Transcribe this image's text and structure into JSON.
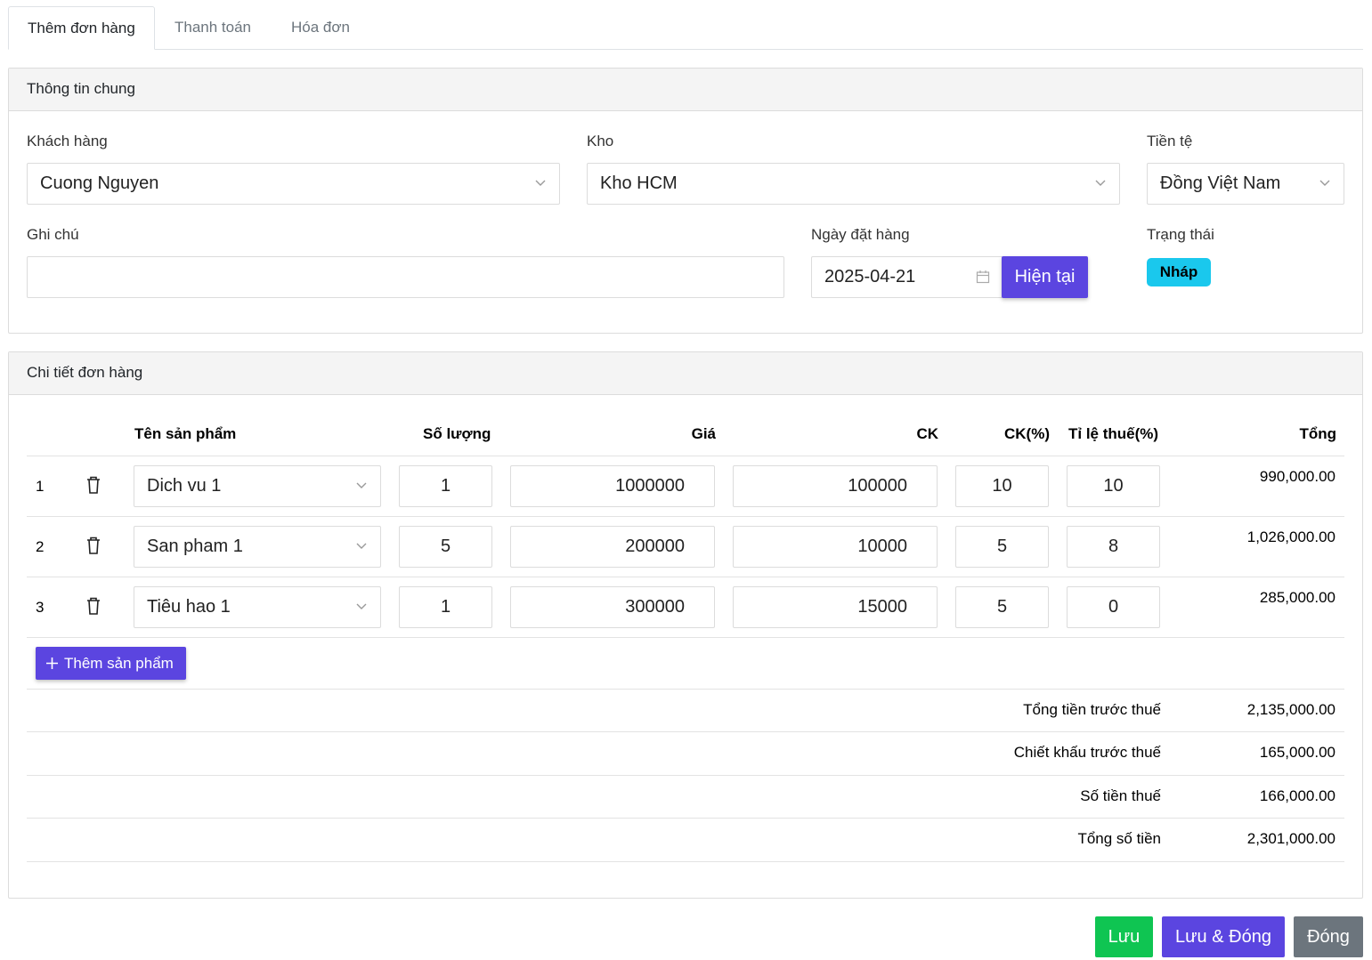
{
  "tabs": [
    {
      "label": "Thêm đơn hàng",
      "active": true
    },
    {
      "label": "Thanh toán",
      "active": false
    },
    {
      "label": "Hóa đơn",
      "active": false
    }
  ],
  "general": {
    "title": "Thông tin chung",
    "customer_label": "Khách hàng",
    "customer_value": "Cuong Nguyen",
    "warehouse_label": "Kho",
    "warehouse_value": "Kho HCM",
    "currency_label": "Tiền tệ",
    "currency_value": "Đồng Việt Nam",
    "note_label": "Ghi chú",
    "note_value": "",
    "order_date_label": "Ngày đặt hàng",
    "order_date_value": "2025-04-21",
    "now_button": "Hiện tại",
    "status_label": "Trạng thái",
    "status_value": "Nháp"
  },
  "details": {
    "title": "Chi tiết đơn hàng",
    "columns": {
      "product": "Tên sản phẩm",
      "quantity": "Số lượng",
      "price": "Giá",
      "discount": "CK",
      "discount_pct": "CK(%)",
      "tax_rate": "Tỉ lệ thuế(%)",
      "total": "Tổng"
    },
    "rows": [
      {
        "index": "1",
        "product": "Dich vu 1",
        "quantity": "1",
        "price": "1000000",
        "discount": "100000",
        "discount_pct": "10",
        "tax_rate": "10",
        "total": "990,000.00"
      },
      {
        "index": "2",
        "product": "San pham 1",
        "quantity": "5",
        "price": "200000",
        "discount": "10000",
        "discount_pct": "5",
        "tax_rate": "8",
        "total": "1,026,000.00"
      },
      {
        "index": "3",
        "product": "Tiêu hao 1",
        "quantity": "1",
        "price": "300000",
        "discount": "15000",
        "discount_pct": "5",
        "tax_rate": "0",
        "total": "285,000.00"
      }
    ],
    "add_product_button": "Thêm sản phẩm",
    "summary": [
      {
        "label": "Tổng tiền trước thuế",
        "value": "2,135,000.00"
      },
      {
        "label": "Chiết khấu trước thuế",
        "value": "165,000.00"
      },
      {
        "label": "Số tiền thuế",
        "value": "166,000.00"
      },
      {
        "label": "Tổng số tiền",
        "value": "2,301,000.00"
      }
    ]
  },
  "footer": {
    "save": "Lưu",
    "save_close": "Lưu & Đóng",
    "close": "Đóng"
  },
  "colors": {
    "primary": "#5b45e0",
    "success": "#0fc552",
    "secondary": "#6c757d",
    "badge": "#1ac8ed"
  }
}
